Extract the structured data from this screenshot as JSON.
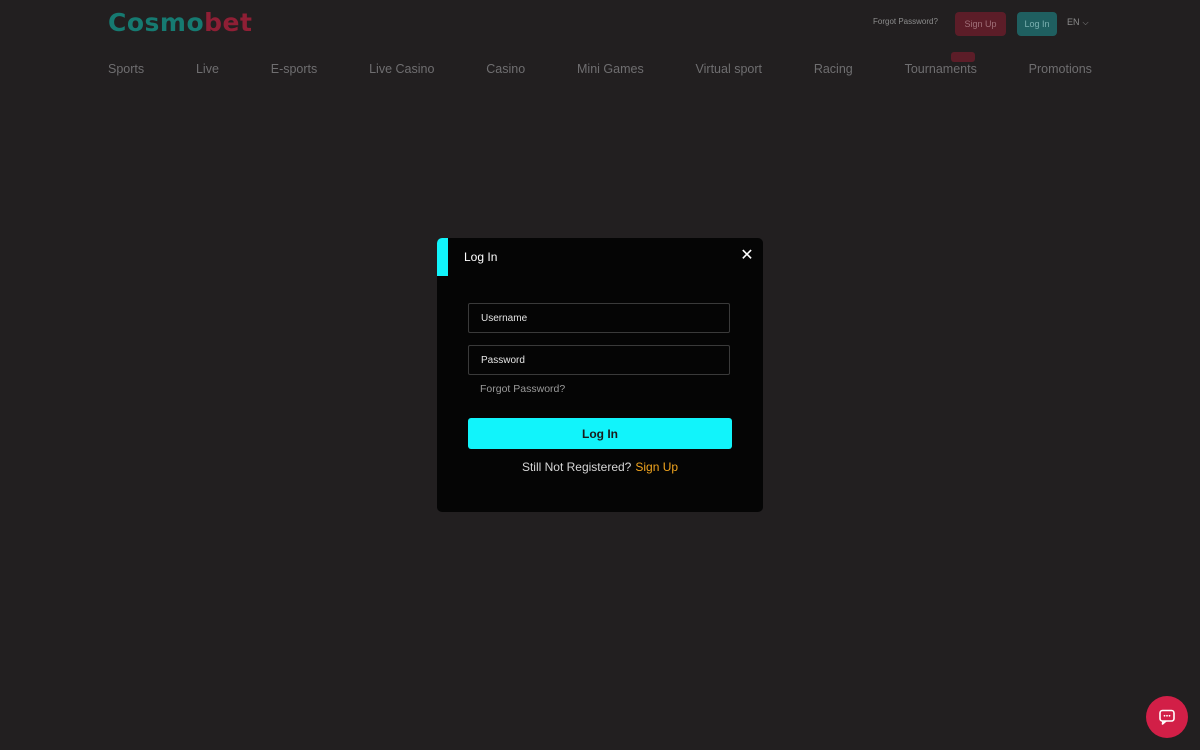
{
  "header": {
    "logo_part1": "Cosmo",
    "logo_part2": "bet",
    "forgot_password": "Forgot Password?",
    "signup_label": "Sign Up",
    "login_label": "Log In",
    "language": "EN",
    "nav": [
      {
        "label": "Sports"
      },
      {
        "label": "Live"
      },
      {
        "label": "E-sports"
      },
      {
        "label": "Live Casino"
      },
      {
        "label": "Casino"
      },
      {
        "label": "Mini Games"
      },
      {
        "label": "Virtual sport"
      },
      {
        "label": "Racing"
      },
      {
        "label": "Tournaments"
      },
      {
        "label": "Promotions"
      }
    ]
  },
  "modal": {
    "title": "Log In",
    "close_icon": "close-icon",
    "username_placeholder": "Username",
    "password_placeholder": "Password",
    "forgot_password": "Forgot Password?",
    "login_button": "Log In",
    "register_question": "Still Not Registered?",
    "register_link": "Sign Up"
  },
  "chat": {
    "icon": "chat-icon"
  },
  "colors": {
    "accent": "#11f4fb",
    "brand_red": "#d21f47",
    "link_orange": "#f2a51e",
    "background": "#221f20",
    "modal_bg": "#050505"
  }
}
